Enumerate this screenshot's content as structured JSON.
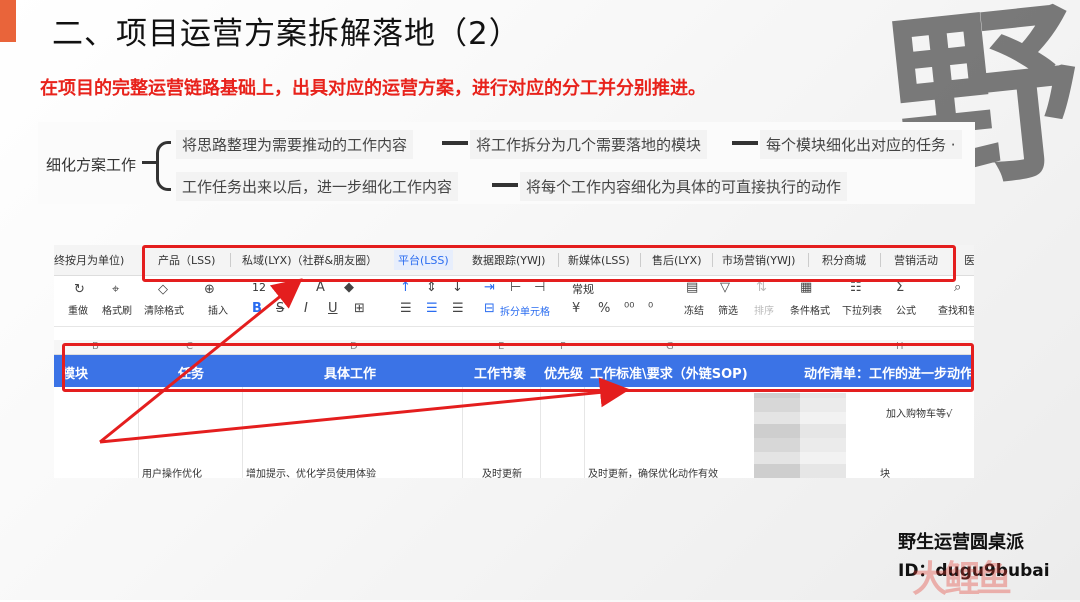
{
  "slide": {
    "title": "二、项目运营方案拆解落地（2）",
    "subtitle": "在项目的完整运营链路基础上，出具对应的运营方案，进行对应的分工并分别推进。",
    "watermark_char": "野"
  },
  "mindmap": {
    "root": "细化方案工作",
    "branch1": [
      "将思路整理为需要推动的工作内容",
      "将工作拆分为几个需要落地的模块",
      "每个模块细化出对应的任务 ·"
    ],
    "branch2": [
      "工作任务出来以后，进一步细化工作内容",
      "将每个工作内容细化为具体的可直接执行的动作"
    ]
  },
  "sheet": {
    "left_tab": "终按月为单位)",
    "tabs": [
      "产品（LSS)",
      "私域(LYX)（社群&朋友圈）",
      "平台(LSS)",
      "数据跟踪(YWJ)",
      "新媒体(LSS)",
      "售后(LYX)",
      "市场营销(YWJ)",
      "积分商城",
      "营销活动",
      "医"
    ],
    "active_tab_index": 2,
    "toolbar": {
      "redo": "重做",
      "format_painter": "格式刷",
      "clear_format": "清除格式",
      "insert": "插入",
      "font_size": "12",
      "merge": "拆分单元格",
      "number_format": "常规",
      "freeze": "冻结",
      "filter": "筛选",
      "sort": "排序",
      "conditional": "条件格式",
      "dropdown": "下拉列表",
      "formula": "公式",
      "find": "查找和替"
    },
    "column_letters": [
      "B",
      "C",
      "D",
      "E",
      "F",
      "G",
      "H"
    ],
    "headers": [
      "模块",
      "任务",
      "具体工作",
      "工作节奏",
      "优先级",
      "工作标准\\要求（外链SOP)",
      "动作清单：工作的进一步动作"
    ],
    "row": {
      "task": "用户操作优化",
      "work": "增加提示、优化学员使用体验",
      "rhythm": "及时更新",
      "standard": "及时更新，确保优化动作有效",
      "action_top": "加入购物车等√",
      "action_bottom": "块"
    }
  },
  "footer": {
    "name": "野生运营圆桌派",
    "id": "ID：dugu9bubai",
    "logo_text": "大鲤鱼"
  },
  "colors": {
    "accent": "#e9643a",
    "subtitle_red": "#e8221b",
    "sheet_header_blue": "#3b73e6",
    "annotation_red": "#e41e1e"
  }
}
